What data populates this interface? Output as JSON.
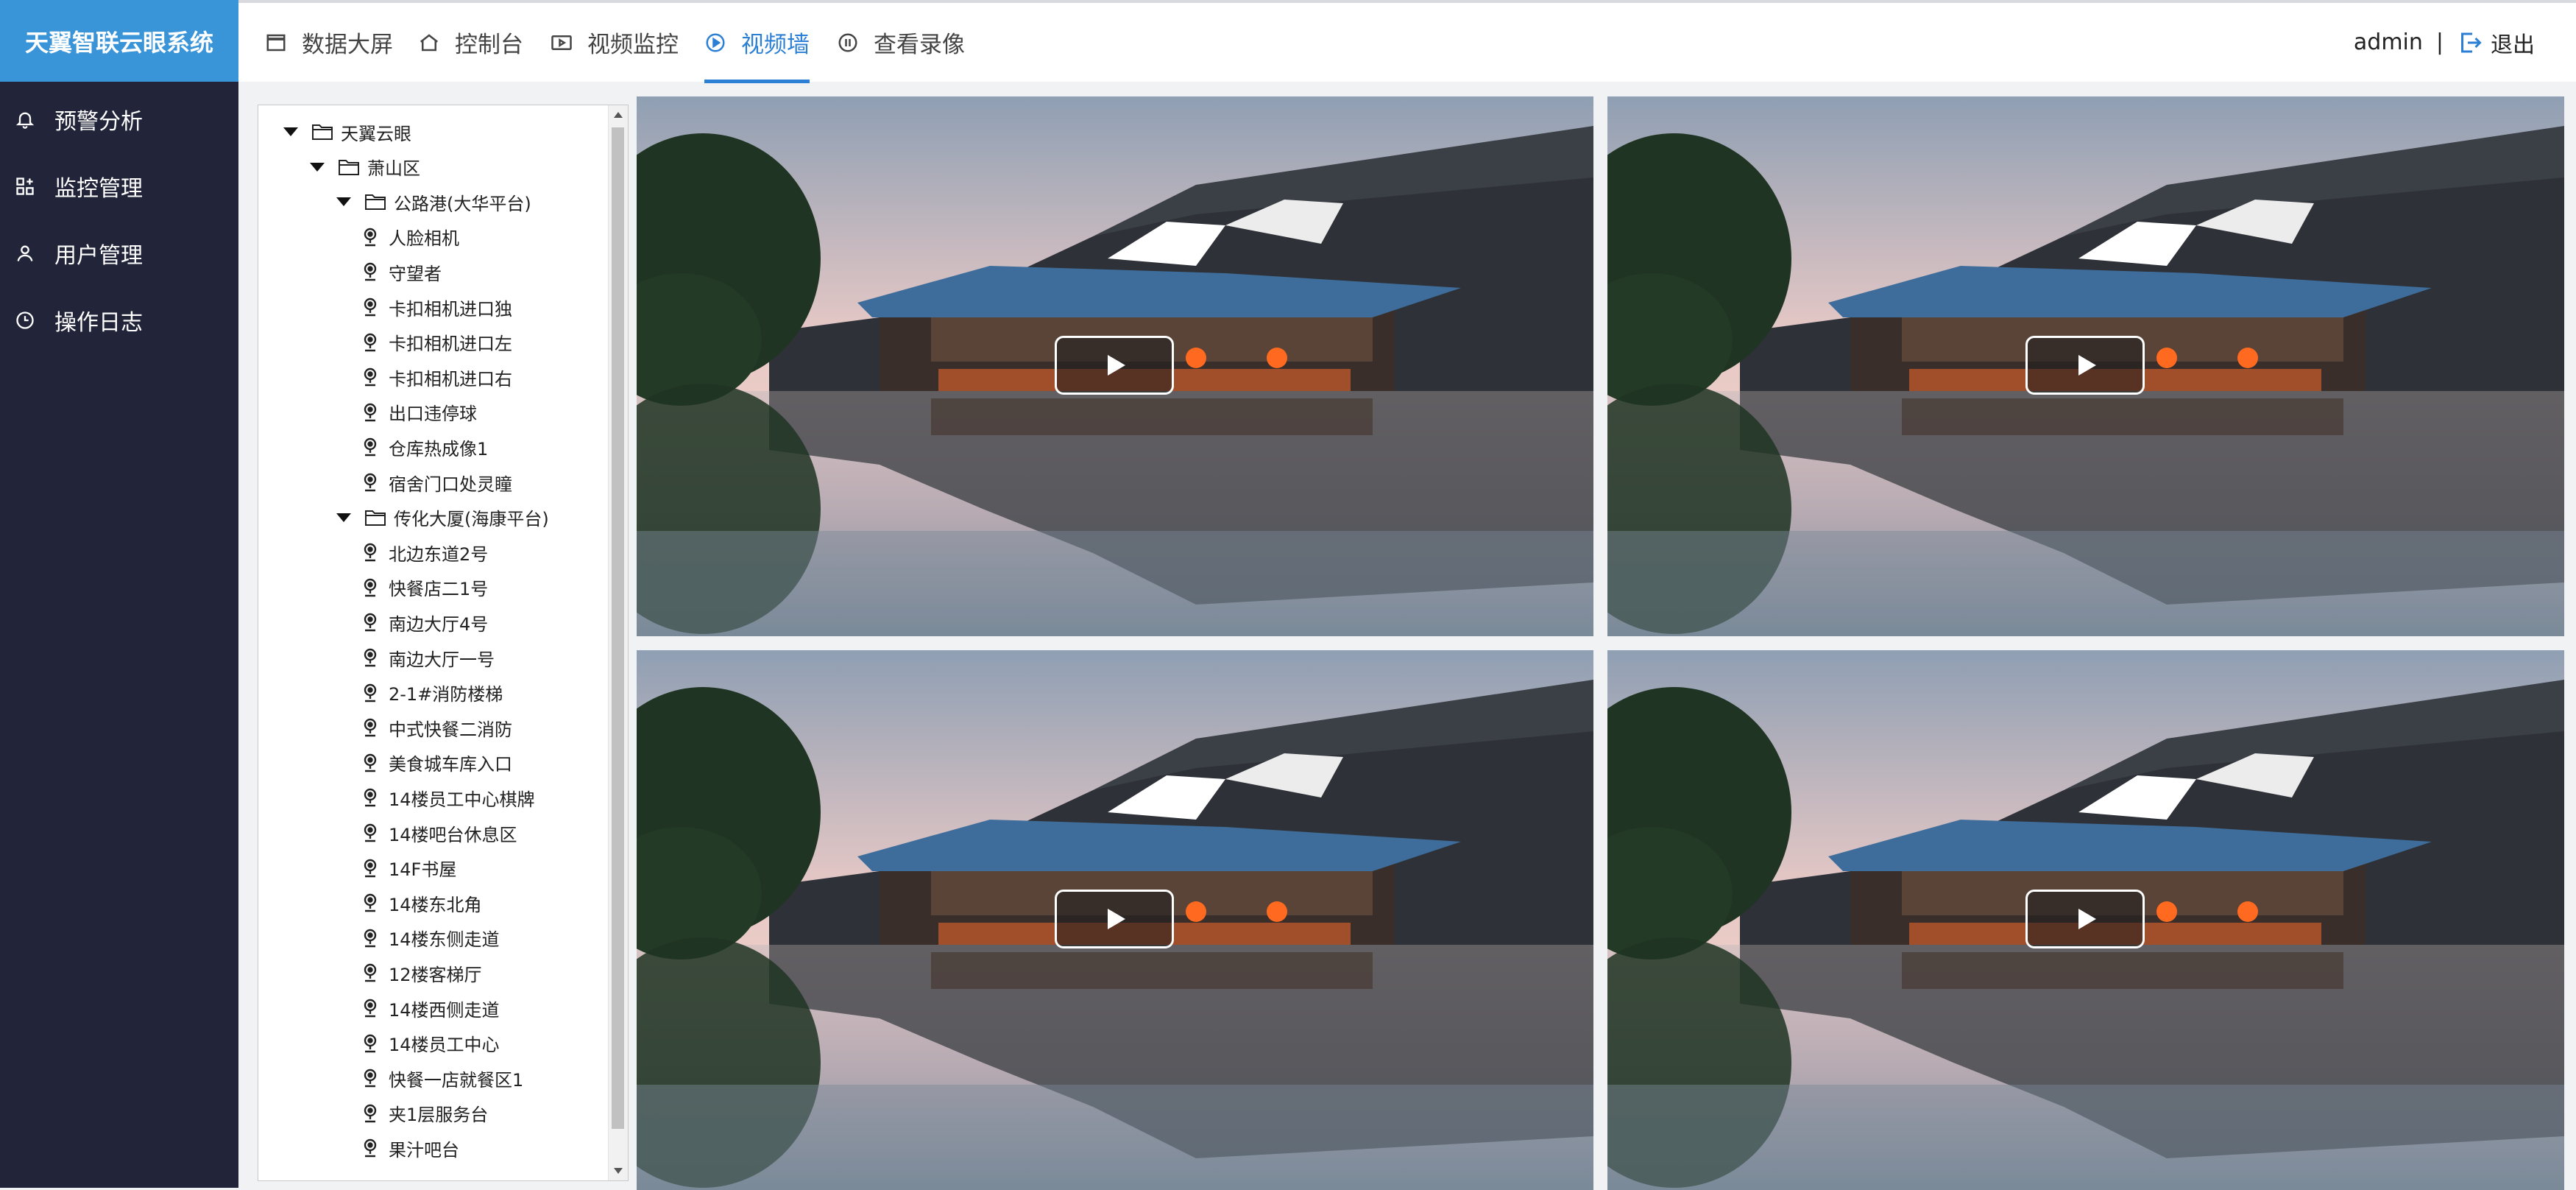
{
  "app": {
    "title": "天翼智联云眼系统"
  },
  "sidebar": {
    "items": [
      {
        "label": "预警分析",
        "icon": "bell-icon"
      },
      {
        "label": "监控管理",
        "icon": "grid-icon"
      },
      {
        "label": "用户管理",
        "icon": "user-icon"
      },
      {
        "label": "操作日志",
        "icon": "clock-icon"
      }
    ]
  },
  "topnav": {
    "items": [
      {
        "label": "数据大屏",
        "icon": "window-icon"
      },
      {
        "label": "控制台",
        "icon": "home-icon"
      },
      {
        "label": "视频监控",
        "icon": "video-icon"
      },
      {
        "label": "视频墙",
        "icon": "play-circle-icon",
        "active": true
      },
      {
        "label": "查看录像",
        "icon": "pause-circle-icon"
      }
    ],
    "active_index": 3
  },
  "user": {
    "name": "admin",
    "separator": "|",
    "logout_label": "退出",
    "logout_icon": "logout-icon"
  },
  "tree": {
    "root": "天翼云眼",
    "district": "萧山区",
    "groups": [
      {
        "label": "公路港(大华平台)",
        "cameras": [
          "人脸相机",
          "守望者",
          "卡扣相机进口独",
          "卡扣相机进口左",
          "卡扣相机进口右",
          "出口违停球",
          "仓库热成像1",
          "宿舍门口处灵瞳"
        ]
      },
      {
        "label": "传化大厦(海康平台)",
        "cameras": [
          "北边东道2号",
          "快餐店二1号",
          "南边大厅4号",
          "南边大厅一号",
          "2-1#消防楼梯",
          "中式快餐二消防",
          "美食城车库入口",
          "14楼员工中心棋牌",
          "14楼吧台休息区",
          "14F书屋",
          "14楼东北角",
          "14楼东侧走道",
          "12楼客梯厅",
          "14楼西侧走道",
          "14楼员工中心",
          "快餐一店就餐区1",
          "夹1层服务台",
          "果汁吧台"
        ]
      }
    ]
  },
  "video_wall": {
    "tiles": 4,
    "play_icon": "play-icon"
  },
  "colors": {
    "brand": "#3a94d8",
    "sidebar_bg": "#22253a",
    "accent": "#2b7fd4"
  }
}
